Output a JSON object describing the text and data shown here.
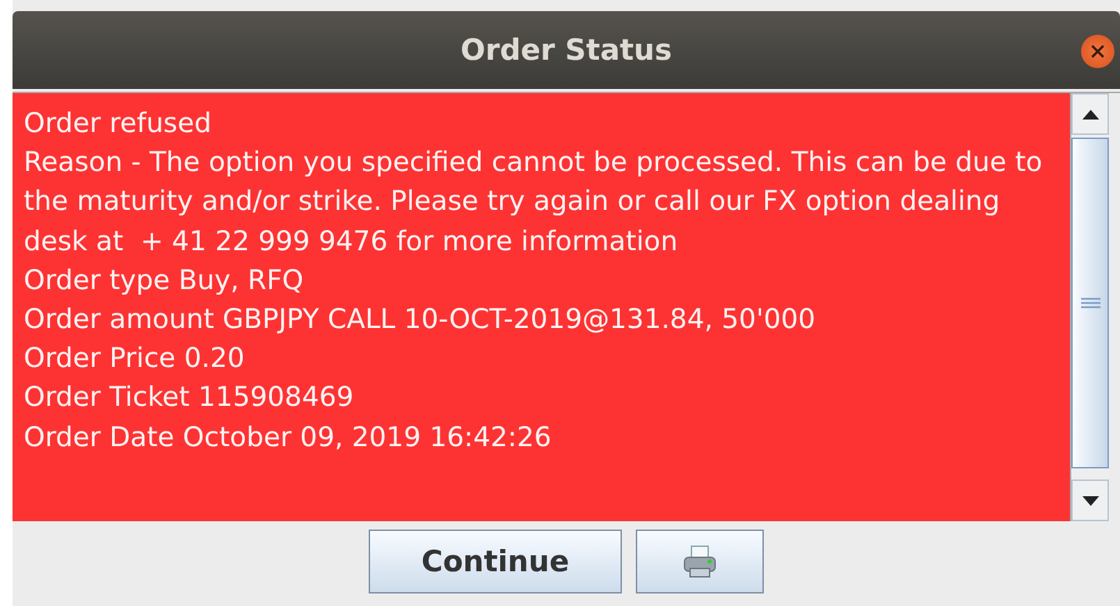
{
  "window": {
    "title": "Order Status"
  },
  "message_lines": [
    "Order refused",
    "Reason - The option you specified cannot be processed. This can be due to the maturity and/or strike. Please try again or call our FX option dealing desk at  + 41 22 999 9476 for more information",
    "Order type Buy, RFQ",
    "Order amount GBPJPY CALL 10-OCT-2019@131.84, 50'000",
    "Order Price 0.20",
    "Order Ticket 115908469",
    "Order Date October 09, 2019 16:42:26"
  ],
  "buttons": [
    {
      "kind": "text",
      "label": "Continue"
    },
    {
      "kind": "print"
    }
  ]
}
